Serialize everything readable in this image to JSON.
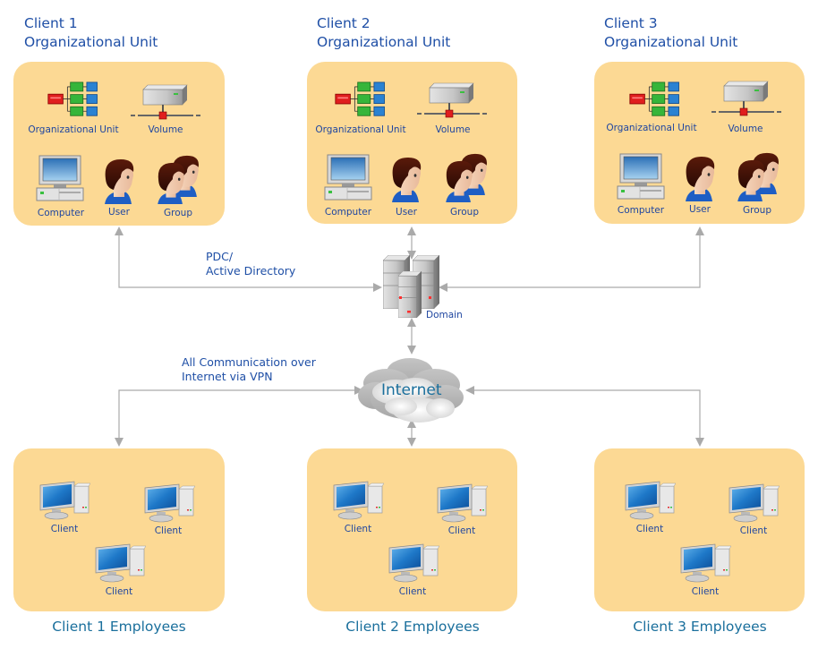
{
  "diagram": {
    "colors": {
      "panel": "#fcd994",
      "title_blue": "#1f4fa6",
      "employee_title": "#1a6f9c",
      "connector": "#aaaaaa"
    },
    "notes": {
      "pdc": [
        "PDC/",
        "Active Directory"
      ],
      "vpn": [
        "All Communication over",
        "Internet via VPN"
      ]
    },
    "domain": {
      "icon": "server-cluster-icon",
      "label": "Domain"
    },
    "internet": {
      "icon": "cloud-icon",
      "label": "Internet"
    },
    "org_units": [
      {
        "title_line1": "Client 1",
        "title_line2": "Organizational Unit",
        "items": [
          {
            "icon": "org-unit-icon",
            "label": "Organizational Unit"
          },
          {
            "icon": "volume-icon",
            "label": "Volume"
          },
          {
            "icon": "computer-icon",
            "label": "Computer"
          },
          {
            "icon": "user-icon",
            "label": "User"
          },
          {
            "icon": "group-icon",
            "label": "Group"
          }
        ]
      },
      {
        "title_line1": "Client 2",
        "title_line2": "Organizational Unit",
        "items": [
          {
            "icon": "org-unit-icon",
            "label": "Organizational Unit"
          },
          {
            "icon": "volume-icon",
            "label": "Volume"
          },
          {
            "icon": "computer-icon",
            "label": "Computer"
          },
          {
            "icon": "user-icon",
            "label": "User"
          },
          {
            "icon": "group-icon",
            "label": "Group"
          }
        ]
      },
      {
        "title_line1": "Client 3",
        "title_line2": "Organizational Unit",
        "items": [
          {
            "icon": "org-unit-icon",
            "label": "Organizational Unit"
          },
          {
            "icon": "volume-icon",
            "label": "Volume"
          },
          {
            "icon": "computer-icon",
            "label": "Computer"
          },
          {
            "icon": "user-icon",
            "label": "User"
          },
          {
            "icon": "group-icon",
            "label": "Group"
          }
        ]
      }
    ],
    "employee_groups": [
      {
        "title": "Client 1 Employees",
        "clients": [
          "Client",
          "Client",
          "Client"
        ]
      },
      {
        "title": "Client 2 Employees",
        "clients": [
          "Client",
          "Client",
          "Client"
        ]
      },
      {
        "title": "Client 3 Employees",
        "clients": [
          "Client",
          "Client",
          "Client"
        ]
      }
    ]
  }
}
